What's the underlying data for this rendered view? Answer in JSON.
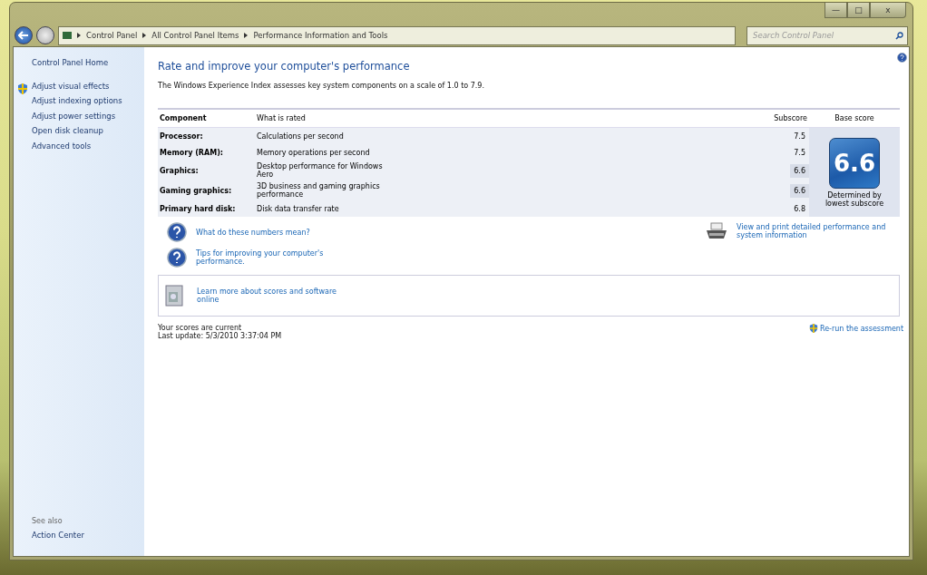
{
  "window": {
    "controls": [
      "—",
      "□",
      "x"
    ]
  },
  "address_bar": {
    "crumbs": [
      "Control Panel",
      "All Control Panel Items",
      "Performance Information and Tools"
    ]
  },
  "search": {
    "placeholder": "Search Control Panel"
  },
  "sidebar": {
    "home": "Control Panel Home",
    "items": [
      {
        "label": "Adjust visual effects",
        "shield": true
      },
      {
        "label": "Adjust indexing options",
        "shield": false
      },
      {
        "label": "Adjust power settings",
        "shield": false
      },
      {
        "label": "Open disk cleanup",
        "shield": false
      },
      {
        "label": "Advanced tools",
        "shield": false
      }
    ],
    "see_also_heading": "See also",
    "see_also": [
      "Action Center"
    ]
  },
  "main": {
    "title": "Rate and improve your computer's performance",
    "intro": "The Windows Experience Index assesses key system components on a scale of 1.0 to 7.9.",
    "table": {
      "columns": [
        "Component",
        "What is rated",
        "Subscore",
        "Base score"
      ],
      "rows": [
        {
          "component": "Processor:",
          "rated": "Calculations per second",
          "subscore": "7.5",
          "lowest": false
        },
        {
          "component": "Memory (RAM):",
          "rated": "Memory operations per second",
          "subscore": "7.5",
          "lowest": false
        },
        {
          "component": "Graphics:",
          "rated": "Desktop performance for Windows Aero",
          "subscore": "6.6",
          "lowest": true
        },
        {
          "component": "Gaming graphics:",
          "rated": "3D business and gaming graphics performance",
          "subscore": "6.6",
          "lowest": true
        },
        {
          "component": "Primary hard disk:",
          "rated": "Disk data transfer rate",
          "subscore": "6.8",
          "lowest": false
        }
      ],
      "base_score": "6.6",
      "base_caption": "Determined by lowest subscore"
    },
    "help_links": [
      "What do these numbers mean?",
      "Tips for improving your computer's performance."
    ],
    "print_link": "View and print detailed performance and system information",
    "learn_more": "Learn more about scores and software online",
    "status": "Your scores are current",
    "last_update": "Last update: 5/3/2010 3:37:04 PM",
    "rerun": "Re-run the assessment"
  }
}
